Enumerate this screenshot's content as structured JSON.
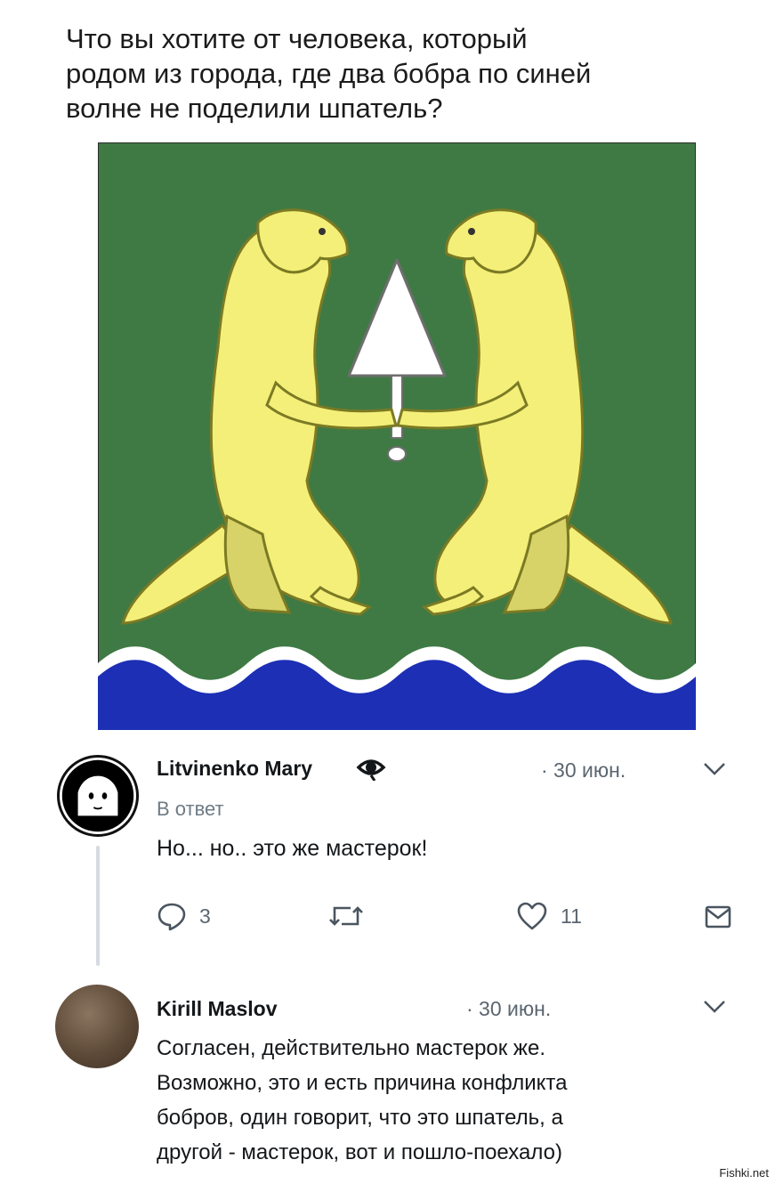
{
  "post": {
    "text": "Что вы хотите от человека, который\nродом из города, где два бобра по синей\nволне не поделили шпатель?"
  },
  "image": {
    "subject": "coat-of-arms",
    "colors": {
      "field": "#3f7a44",
      "waves": "#1c2fb5",
      "beaver": "#f4ef78",
      "trowel": "#ffffff"
    }
  },
  "tweets": [
    {
      "author": "Litvinenko Mary",
      "badge_icon": "eye-icon",
      "date": "· 30 июн.",
      "reply_label": "В ответ",
      "text": "Но... но.. это же мастерок!",
      "actions": {
        "reply_count": "3",
        "retweet_count": "",
        "like_count": "11"
      }
    },
    {
      "author": "Kirill Maslov",
      "date": "· 30 июн.",
      "text": "Согласен, действительно мастерок же.\nВозможно, это и есть причина конфликта\nбобров, один говорит, что это шпатель, а\nдругой - мастерок, вот и пошло-поехало)"
    }
  ],
  "watermark": "Fishki.net"
}
